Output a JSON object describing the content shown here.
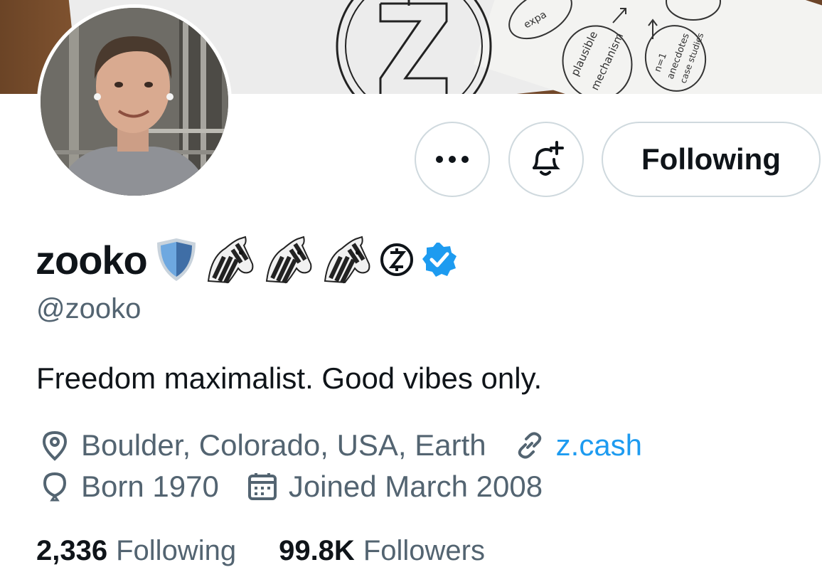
{
  "profile": {
    "name": "zooko",
    "handle": "@zooko",
    "bio": "Freedom maximalist. Good vibes only.",
    "location": "Boulder, Colorado, USA, Earth",
    "website": "z.cash",
    "born": "Born 1970",
    "joined": "Joined March 2008",
    "verified_color": "#1d9bf0"
  },
  "banner": {
    "sketch_texts": [
      "expa",
      "plausible",
      "mechanism",
      "n=1",
      "anecdotes",
      "case studies"
    ]
  },
  "actions": {
    "more_icon": "more-icon",
    "bell_icon": "bell-plus-icon",
    "follow_label": "Following"
  },
  "stats": {
    "following_count": "2,336",
    "following_label": "Following",
    "followers_count": "99.8K",
    "followers_label": "Followers"
  }
}
